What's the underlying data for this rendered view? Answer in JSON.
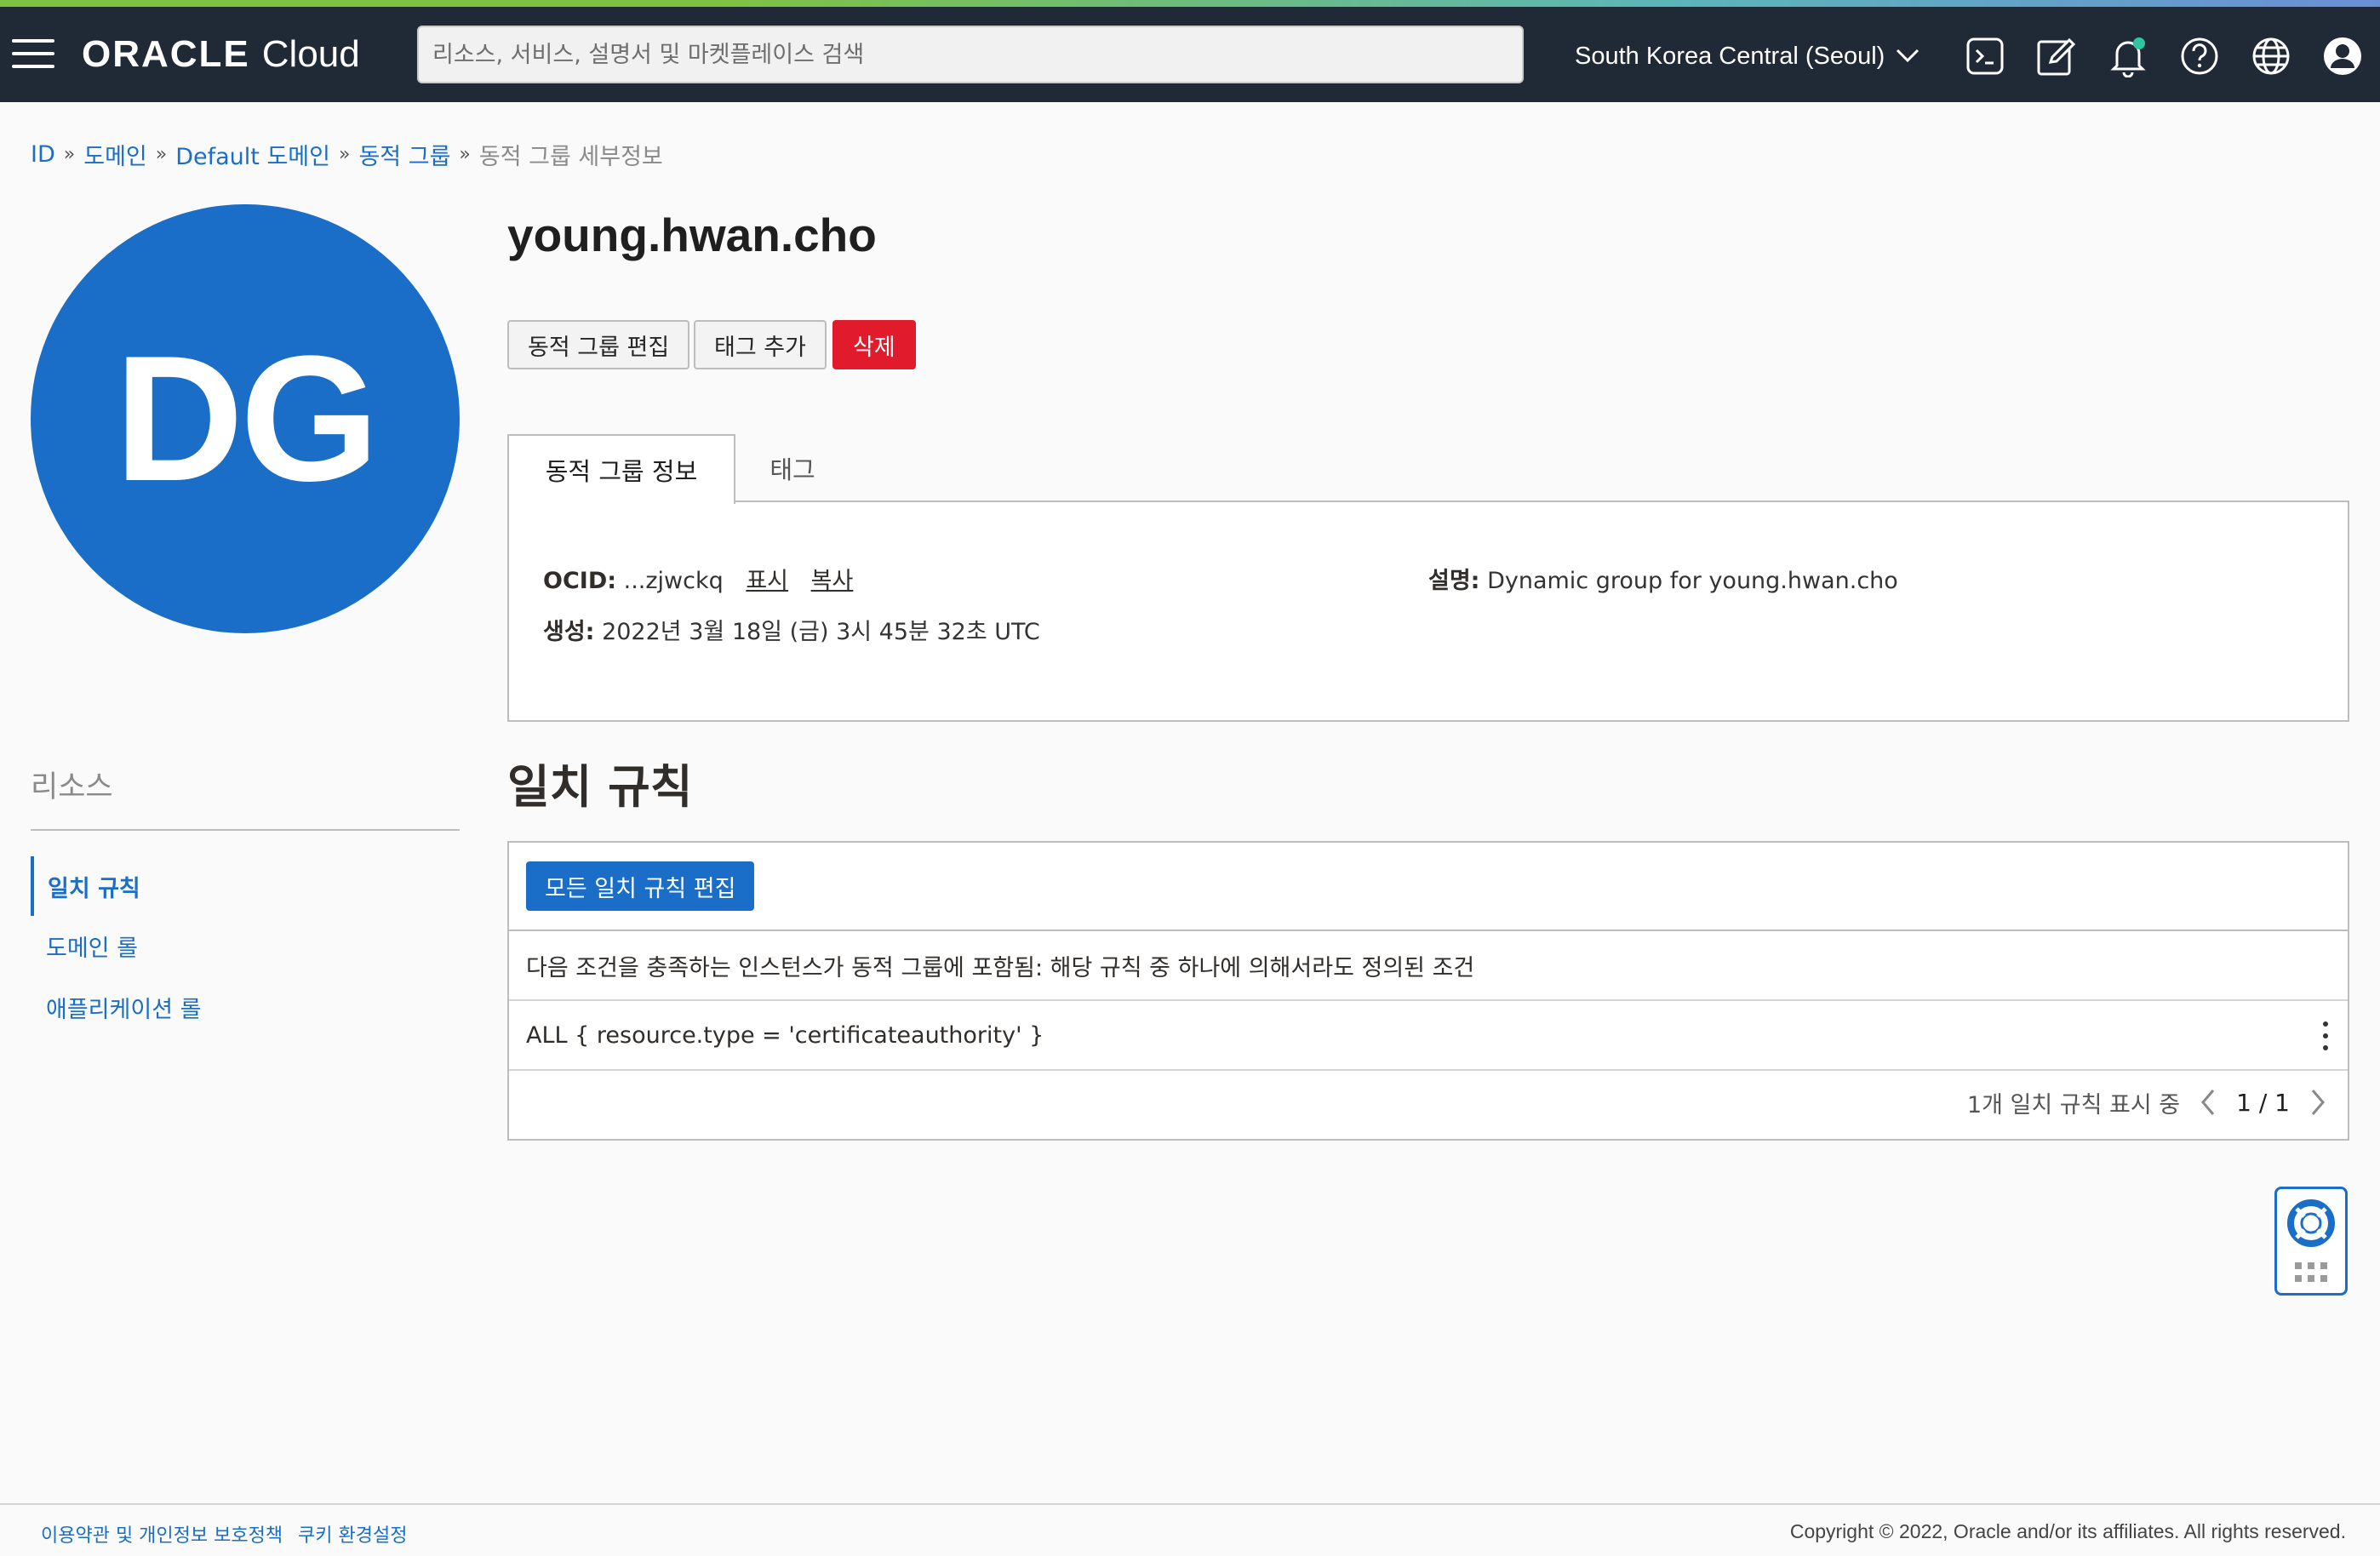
{
  "header": {
    "brand_oracle": "ORACLE",
    "brand_cloud": "Cloud",
    "search_placeholder": "리소스, 서비스, 설명서 및 마켓플레이스 검색",
    "region": "South Korea Central (Seoul)",
    "icons": [
      "menu-icon",
      "cloud-shell-icon",
      "edit-icon",
      "bell-icon",
      "help-icon",
      "globe-icon",
      "user-icon"
    ]
  },
  "breadcrumb": {
    "items": [
      "ID",
      "도메인",
      "Default 도메인",
      "동적 그룹"
    ],
    "current": "동적 그룹 세부정보"
  },
  "avatar": {
    "initials": "DG",
    "color": "#1a6ec7"
  },
  "group": {
    "name": "young.hwan.cho",
    "actions": {
      "edit": "동적 그룹 편집",
      "add_tags": "태그 추가",
      "delete": "삭제"
    }
  },
  "tabs": {
    "info": "동적 그룹 정보",
    "tags": "태그"
  },
  "info": {
    "ocid_label": "OCID:",
    "ocid_value": "...zjwckq",
    "show_link": "표시",
    "copy_link": "복사",
    "created_label": "생성:",
    "created_value": "2022년 3월 18일 (금) 3시 45분 32초 UTC",
    "description_label": "설명:",
    "description_value": "Dynamic group for young.hwan.cho"
  },
  "resources": {
    "title": "리소스",
    "items": [
      "일치 규칙",
      "도메인 롤",
      "애플리케이션 롤"
    ],
    "active_index": 0
  },
  "rules": {
    "title": "일치 규칙",
    "edit_all_button": "모든 일치 규칙 편집",
    "condition_text": "다음 조건을 충족하는 인스턴스가 동적 그룹에 포함됨: 해당 규칙 중 하나에 의해서라도 정의된 조건",
    "rows": [
      "ALL { resource.type = 'certificateauthority' }"
    ],
    "pager_summary": "1개 일치 규칙 표시 중",
    "pager_page": "1 / 1"
  },
  "footer": {
    "terms": "이용약관 및 개인정보 보호정책",
    "cookies": "쿠키 환경설정",
    "copyright": "Copyright © 2022, Oracle and/or its affiliates. All rights reserved."
  },
  "colors": {
    "header_bg": "#1f2a36",
    "link": "#1a6ec7",
    "danger": "#e11b2b"
  }
}
